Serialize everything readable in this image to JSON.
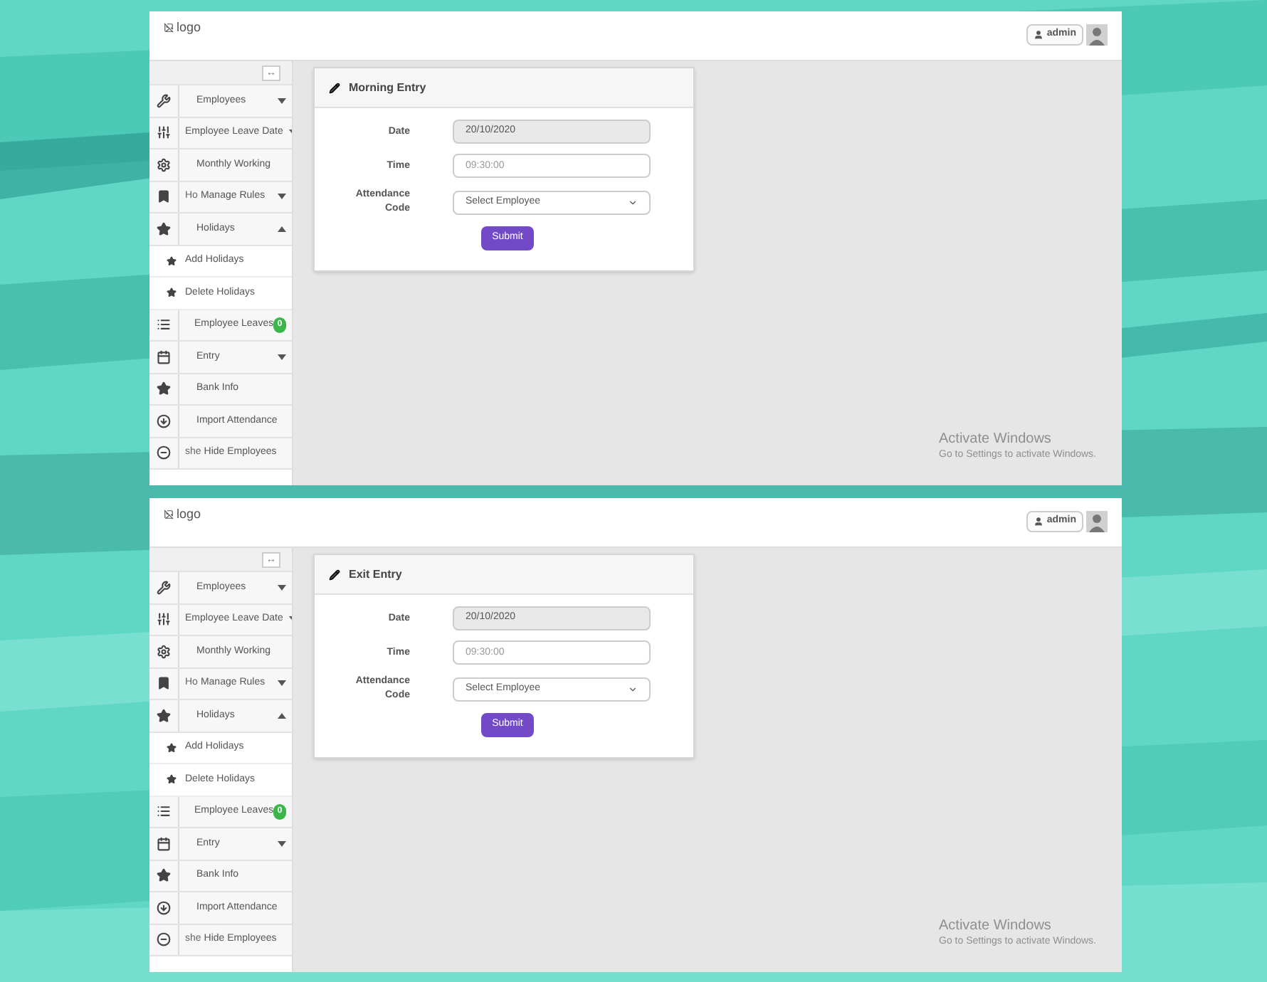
{
  "screens": [
    {
      "logo_alt": "logo",
      "user": "admin",
      "toggle": "↔",
      "form": {
        "title": "Morning Entry",
        "fields": [
          {
            "kind": "readonly",
            "label": "Date",
            "value": "20/10/2020"
          },
          {
            "kind": "text",
            "label": "Time",
            "placeholder": "09:30:00"
          },
          {
            "kind": "select",
            "label": "Attendance Code",
            "value": "Select Employee"
          }
        ],
        "submit": "Submit"
      },
      "menu": [
        {
          "kind": "dropdown",
          "label": "Employees",
          "expanded": false
        },
        {
          "kind": "dropdown",
          "label": "Employee Leave Date",
          "expanded": false
        },
        {
          "kind": "link",
          "label": "Monthly Working"
        },
        {
          "kind": "dropdown",
          "label": "Manage Rules",
          "ghost": "Ho",
          "expanded": false
        },
        {
          "kind": "dropdown",
          "label": "Holidays",
          "expanded": true
        },
        {
          "kind": "sub",
          "label": "Add Holidays"
        },
        {
          "kind": "sub",
          "label": "Delete Holidays"
        },
        {
          "kind": "link",
          "label": "Employee Leaves",
          "badge": "0"
        },
        {
          "kind": "dropdown",
          "label": "Entry",
          "expanded": false
        },
        {
          "kind": "link",
          "label": "Bank Info"
        },
        {
          "kind": "link",
          "label": "Import Attendance"
        },
        {
          "kind": "link",
          "label": "Hide Employees",
          "ghost": "she"
        }
      ],
      "notice": {
        "title": "Activate Windows",
        "text": "Go to Settings to activate Windows."
      }
    },
    {
      "logo_alt": "logo",
      "user": "admin",
      "toggle": "↔",
      "form": {
        "title": "Exit Entry",
        "fields": [
          {
            "kind": "readonly",
            "label": "Date",
            "value": "20/10/2020"
          },
          {
            "kind": "text",
            "label": "Time",
            "placeholder": "09:30:00"
          },
          {
            "kind": "select",
            "label": "Attendance Code",
            "value": "Select Employee"
          }
        ],
        "submit": "Submit"
      },
      "menu": [
        {
          "kind": "dropdown",
          "label": "Employees",
          "expanded": false
        },
        {
          "kind": "dropdown",
          "label": "Employee Leave Date",
          "expanded": false
        },
        {
          "kind": "link",
          "label": "Monthly Working"
        },
        {
          "kind": "dropdown",
          "label": "Manage Rules",
          "ghost": "Ho",
          "expanded": false
        },
        {
          "kind": "dropdown",
          "label": "Holidays",
          "expanded": true
        },
        {
          "kind": "sub",
          "label": "Add Holidays"
        },
        {
          "kind": "sub",
          "label": "Delete Holidays"
        },
        {
          "kind": "link",
          "label": "Employee Leaves",
          "badge": "0"
        },
        {
          "kind": "dropdown",
          "label": "Entry",
          "expanded": false
        },
        {
          "kind": "link",
          "label": "Bank Info"
        },
        {
          "kind": "link",
          "label": "Import Attendance"
        },
        {
          "kind": "link",
          "label": "Hide Employees",
          "ghost": "she"
        }
      ],
      "notice": {
        "title": "Activate Windows",
        "text": "Go to Settings to activate Windows."
      }
    }
  ]
}
